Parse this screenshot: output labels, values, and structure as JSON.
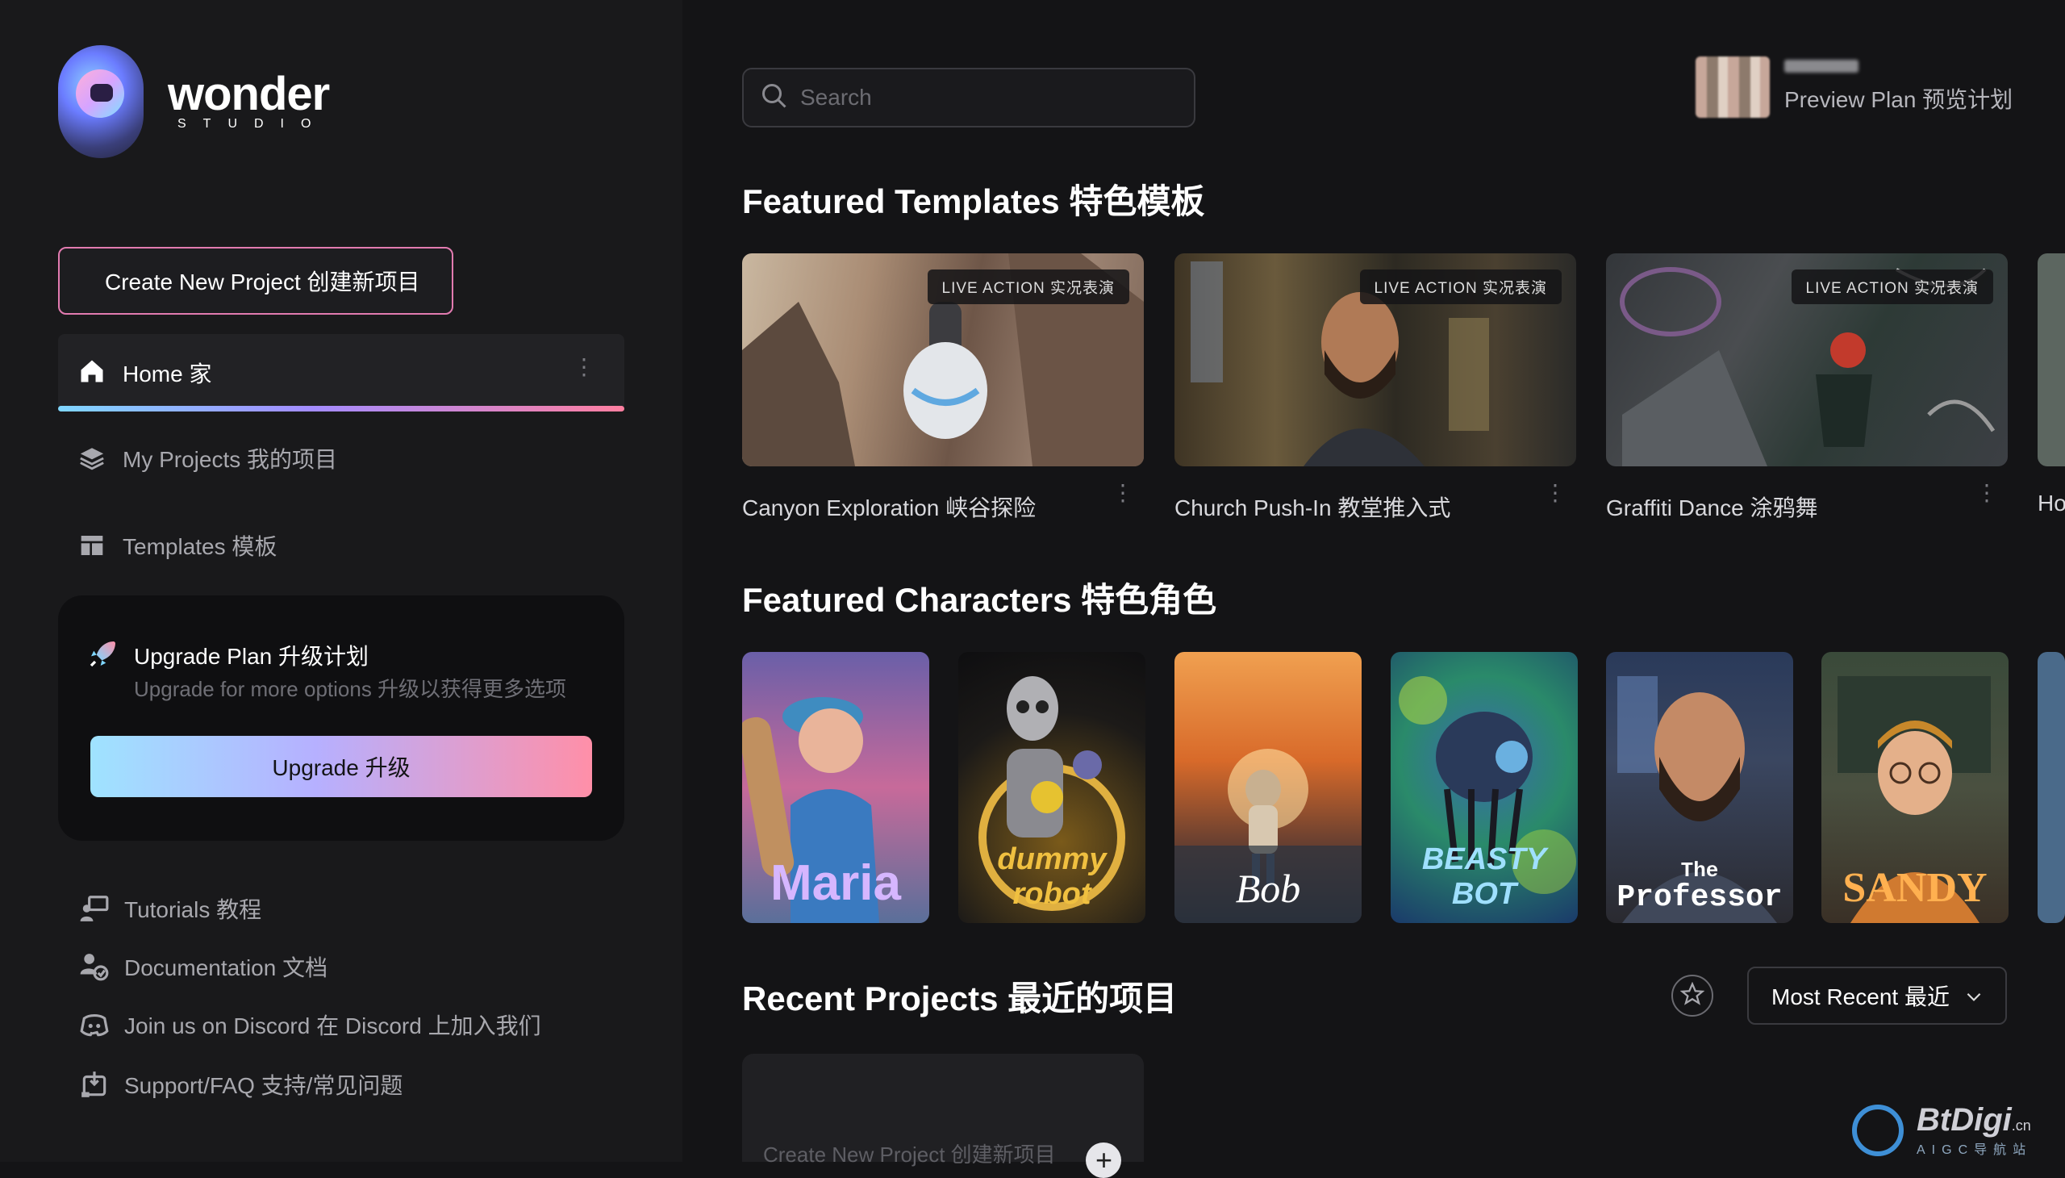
{
  "brand": {
    "name": "wonder",
    "sub": "STUDIO"
  },
  "sidebar": {
    "create_button": "Create New Project 创建新项目",
    "nav": [
      {
        "label": "Home 家",
        "icon": "home-icon",
        "active": true
      },
      {
        "label": "My Projects 我的项目",
        "icon": "layers-icon"
      },
      {
        "label": "Templates 模板",
        "icon": "templates-icon"
      }
    ],
    "upgrade": {
      "title": "Upgrade Plan 升级计划",
      "subtitle": "Upgrade for more options 升级以获得更多选项",
      "button": "Upgrade 升级"
    },
    "links": [
      {
        "label": "Tutorials 教程",
        "icon": "tutorial-icon"
      },
      {
        "label": "Documentation 文档",
        "icon": "documentation-icon"
      },
      {
        "label": "Join us on Discord 在 Discord 上加入我们",
        "icon": "discord-icon"
      },
      {
        "label": "Support/FAQ 支持/常见问题",
        "icon": "support-icon"
      }
    ]
  },
  "header": {
    "search_placeholder": "Search",
    "plan": "Preview Plan 预览计划"
  },
  "featured_templates": {
    "title": "Featured Templates 特色模板",
    "items": [
      {
        "name": "Canyon Exploration 峡谷探险",
        "badge": "LIVE ACTION 实况表演"
      },
      {
        "name": "Church Push-In 教堂推入式",
        "badge": "LIVE ACTION 实况表演"
      },
      {
        "name": "Graffiti Dance 涂鸦舞",
        "badge": "LIVE ACTION 实况表演"
      },
      {
        "name": "Ho"
      }
    ]
  },
  "featured_characters": {
    "title": "Featured Characters 特色角色",
    "items": [
      {
        "name": "Maria"
      },
      {
        "name": "dummy robot"
      },
      {
        "name": "Bob"
      },
      {
        "name": "BEASTY BOT"
      },
      {
        "name": "The Professor"
      },
      {
        "name": "SANDY"
      }
    ]
  },
  "recent_projects": {
    "title": "Recent Projects 最近的项目",
    "sort_label": "Most Recent 最近",
    "new_card_label": "Create New Project 创建新项目"
  },
  "watermark": {
    "main": "BtDigi",
    "suffix": ".cn",
    "sub": "AIGC导航站"
  },
  "colors": {
    "accent_start": "#7fd6ff",
    "accent_mid": "#a48cff",
    "accent_end": "#ff7fa0",
    "background": "#141416"
  }
}
